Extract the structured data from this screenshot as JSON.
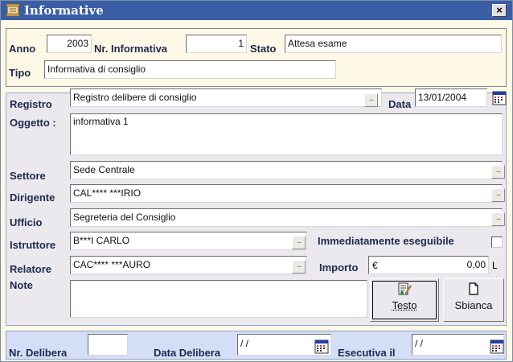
{
  "window": {
    "title": "Informative",
    "close_label": "×"
  },
  "header": {
    "anno_label": "Anno",
    "anno_value": "2003",
    "nr_label": "Nr. Informativa",
    "nr_value": "1",
    "stato_label": "Stato",
    "stato_value": "Attesa esame",
    "tipo_label": "Tipo",
    "tipo_value": "Informativa di consiglio"
  },
  "form": {
    "registro_label": "Registro",
    "registro_value": "Registro delibere di consiglio",
    "data_label": "Data",
    "data_value": "13/01/2004",
    "oggetto_label": "Oggetto :",
    "oggetto_value": "informativa 1",
    "settore_label": "Settore",
    "settore_value": "Sede Centrale",
    "dirigente_label": "Dirigente",
    "dirigente_value": "CAL**** ***IRIO",
    "ufficio_label": "Ufficio",
    "ufficio_value": "Segreteria del Consiglio",
    "istruttore_label": "Istruttore",
    "istruttore_value": "B***I  CARLO",
    "immediatamente_label": "Immediatamente eseguibile",
    "relatore_label": "Relatore",
    "relatore_value": "CAC**** ***AURO",
    "importo_label": "Importo",
    "importo_currency": "€",
    "importo_value": "0,00",
    "importo_unit": "L",
    "note_label": "Note",
    "note_value": "",
    "dots_label": "...",
    "testo_button": "Testo",
    "sbianca_button": "Sbianca"
  },
  "footer": {
    "nr_delibera_label": "Nr. Delibera",
    "nr_delibera_value": "",
    "data_delibera_label": "Data Delibera",
    "data_delibera_value": "/ /",
    "esecutiva_label": "Esecutiva il",
    "esecutiva_value": "/ /"
  },
  "colors": {
    "titlebar": "#3a5ea6",
    "top_panel": "#FEF9E7",
    "main_panel": "#EBE8EE",
    "bottom_panel": "#D4DEF6",
    "label_text": "#1d2a4d"
  },
  "icons": {
    "app": "scroll-icon",
    "calendar": "calendar-icon",
    "dots": "ellipsis-icon",
    "testo": "document-edit-icon",
    "sbianca": "blank-page-icon"
  }
}
